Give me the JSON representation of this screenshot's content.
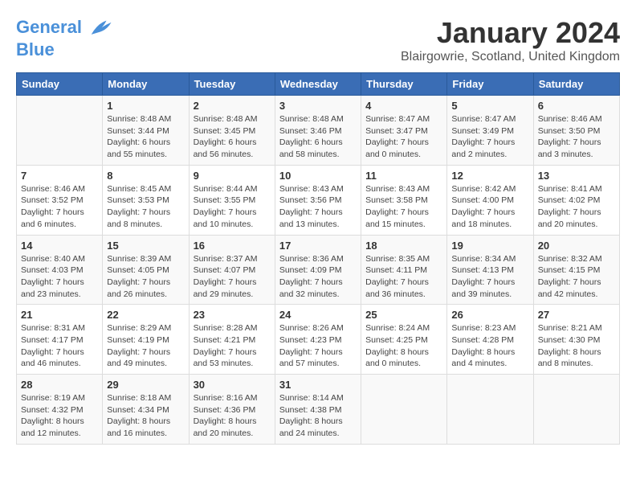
{
  "header": {
    "logo_line1": "General",
    "logo_line2": "Blue",
    "title": "January 2024",
    "location": "Blairgowrie, Scotland, United Kingdom"
  },
  "calendar": {
    "weekdays": [
      "Sunday",
      "Monday",
      "Tuesday",
      "Wednesday",
      "Thursday",
      "Friday",
      "Saturday"
    ],
    "weeks": [
      [
        {
          "day": "",
          "info": ""
        },
        {
          "day": "1",
          "info": "Sunrise: 8:48 AM\nSunset: 3:44 PM\nDaylight: 6 hours\nand 55 minutes."
        },
        {
          "day": "2",
          "info": "Sunrise: 8:48 AM\nSunset: 3:45 PM\nDaylight: 6 hours\nand 56 minutes."
        },
        {
          "day": "3",
          "info": "Sunrise: 8:48 AM\nSunset: 3:46 PM\nDaylight: 6 hours\nand 58 minutes."
        },
        {
          "day": "4",
          "info": "Sunrise: 8:47 AM\nSunset: 3:47 PM\nDaylight: 7 hours\nand 0 minutes."
        },
        {
          "day": "5",
          "info": "Sunrise: 8:47 AM\nSunset: 3:49 PM\nDaylight: 7 hours\nand 2 minutes."
        },
        {
          "day": "6",
          "info": "Sunrise: 8:46 AM\nSunset: 3:50 PM\nDaylight: 7 hours\nand 3 minutes."
        }
      ],
      [
        {
          "day": "7",
          "info": "Sunrise: 8:46 AM\nSunset: 3:52 PM\nDaylight: 7 hours\nand 6 minutes."
        },
        {
          "day": "8",
          "info": "Sunrise: 8:45 AM\nSunset: 3:53 PM\nDaylight: 7 hours\nand 8 minutes."
        },
        {
          "day": "9",
          "info": "Sunrise: 8:44 AM\nSunset: 3:55 PM\nDaylight: 7 hours\nand 10 minutes."
        },
        {
          "day": "10",
          "info": "Sunrise: 8:43 AM\nSunset: 3:56 PM\nDaylight: 7 hours\nand 13 minutes."
        },
        {
          "day": "11",
          "info": "Sunrise: 8:43 AM\nSunset: 3:58 PM\nDaylight: 7 hours\nand 15 minutes."
        },
        {
          "day": "12",
          "info": "Sunrise: 8:42 AM\nSunset: 4:00 PM\nDaylight: 7 hours\nand 18 minutes."
        },
        {
          "day": "13",
          "info": "Sunrise: 8:41 AM\nSunset: 4:02 PM\nDaylight: 7 hours\nand 20 minutes."
        }
      ],
      [
        {
          "day": "14",
          "info": "Sunrise: 8:40 AM\nSunset: 4:03 PM\nDaylight: 7 hours\nand 23 minutes."
        },
        {
          "day": "15",
          "info": "Sunrise: 8:39 AM\nSunset: 4:05 PM\nDaylight: 7 hours\nand 26 minutes."
        },
        {
          "day": "16",
          "info": "Sunrise: 8:37 AM\nSunset: 4:07 PM\nDaylight: 7 hours\nand 29 minutes."
        },
        {
          "day": "17",
          "info": "Sunrise: 8:36 AM\nSunset: 4:09 PM\nDaylight: 7 hours\nand 32 minutes."
        },
        {
          "day": "18",
          "info": "Sunrise: 8:35 AM\nSunset: 4:11 PM\nDaylight: 7 hours\nand 36 minutes."
        },
        {
          "day": "19",
          "info": "Sunrise: 8:34 AM\nSunset: 4:13 PM\nDaylight: 7 hours\nand 39 minutes."
        },
        {
          "day": "20",
          "info": "Sunrise: 8:32 AM\nSunset: 4:15 PM\nDaylight: 7 hours\nand 42 minutes."
        }
      ],
      [
        {
          "day": "21",
          "info": "Sunrise: 8:31 AM\nSunset: 4:17 PM\nDaylight: 7 hours\nand 46 minutes."
        },
        {
          "day": "22",
          "info": "Sunrise: 8:29 AM\nSunset: 4:19 PM\nDaylight: 7 hours\nand 49 minutes."
        },
        {
          "day": "23",
          "info": "Sunrise: 8:28 AM\nSunset: 4:21 PM\nDaylight: 7 hours\nand 53 minutes."
        },
        {
          "day": "24",
          "info": "Sunrise: 8:26 AM\nSunset: 4:23 PM\nDaylight: 7 hours\nand 57 minutes."
        },
        {
          "day": "25",
          "info": "Sunrise: 8:24 AM\nSunset: 4:25 PM\nDaylight: 8 hours\nand 0 minutes."
        },
        {
          "day": "26",
          "info": "Sunrise: 8:23 AM\nSunset: 4:28 PM\nDaylight: 8 hours\nand 4 minutes."
        },
        {
          "day": "27",
          "info": "Sunrise: 8:21 AM\nSunset: 4:30 PM\nDaylight: 8 hours\nand 8 minutes."
        }
      ],
      [
        {
          "day": "28",
          "info": "Sunrise: 8:19 AM\nSunset: 4:32 PM\nDaylight: 8 hours\nand 12 minutes."
        },
        {
          "day": "29",
          "info": "Sunrise: 8:18 AM\nSunset: 4:34 PM\nDaylight: 8 hours\nand 16 minutes."
        },
        {
          "day": "30",
          "info": "Sunrise: 8:16 AM\nSunset: 4:36 PM\nDaylight: 8 hours\nand 20 minutes."
        },
        {
          "day": "31",
          "info": "Sunrise: 8:14 AM\nSunset: 4:38 PM\nDaylight: 8 hours\nand 24 minutes."
        },
        {
          "day": "",
          "info": ""
        },
        {
          "day": "",
          "info": ""
        },
        {
          "day": "",
          "info": ""
        }
      ]
    ]
  }
}
